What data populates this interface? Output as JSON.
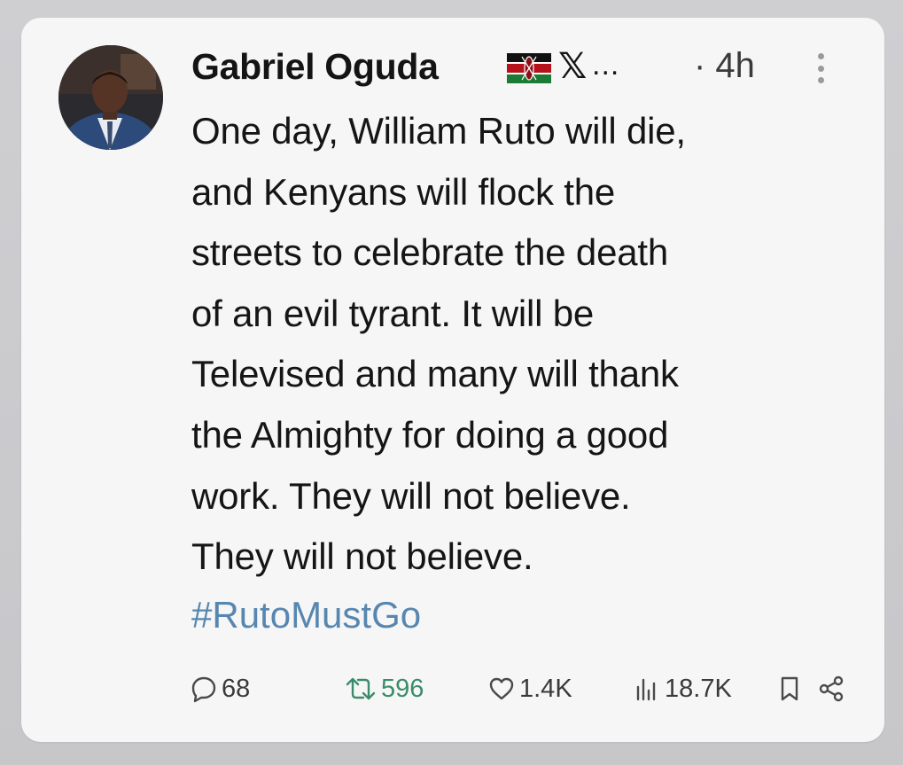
{
  "post": {
    "author": {
      "display_name": "Gabriel Oguda",
      "flag_icon": "kenya-flag-icon",
      "x_mark": "𝕏",
      "truncation": "...",
      "time_ago": "· 4h"
    },
    "body_lines": [
      "One day, William Ruto will die,",
      "and Kenyans will flock the",
      "streets to celebrate the death",
      "of an evil tyrant. It will be",
      "Televised and many will thank",
      "the Almighty for doing a good",
      "work. They will not believe.",
      "They will not believe."
    ],
    "hashtag": "#RutoMustGo",
    "metrics": {
      "replies": "68",
      "reposts": "596",
      "likes": "1.4K",
      "views": "18.7K"
    }
  },
  "colors": {
    "hashtag": "#5787b0",
    "repost": "#3a8c6a",
    "card_bg": "#f6f6f7",
    "text": "#151515"
  },
  "icons": {
    "reply": "reply-icon",
    "repost": "repost-icon",
    "like": "heart-icon",
    "views": "views-icon",
    "bookmark": "bookmark-icon",
    "share": "share-icon",
    "more": "more-options-icon"
  }
}
